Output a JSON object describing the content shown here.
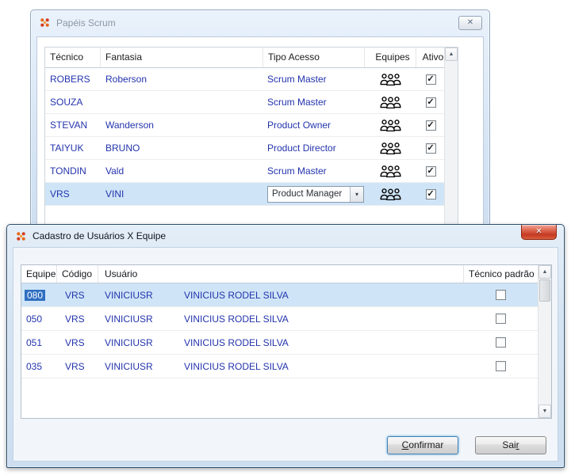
{
  "icons": {
    "close": "✕",
    "check": "✓",
    "dropdown": "▾",
    "scroll_up": "▲",
    "scroll_down": "▼"
  },
  "papeis": {
    "title": "Papéis Scrum",
    "headers": {
      "tecnico": "Técnico",
      "fantasia": "Fantasia",
      "tipo": "Tipo Acesso",
      "equipes": "Equipes",
      "ativo": "Ativo"
    },
    "rows": [
      {
        "tecnico": "ROBERS",
        "fantasia": "Roberson",
        "tipo": "Scrum Master",
        "ativo": true
      },
      {
        "tecnico": "SOUZA",
        "fantasia": "",
        "tipo": "Scrum Master",
        "ativo": true
      },
      {
        "tecnico": "STEVAN",
        "fantasia": "Wanderson",
        "tipo": "Product Owner",
        "ativo": true
      },
      {
        "tecnico": "TAIYUK",
        "fantasia": "BRUNO",
        "tipo": "Product Director",
        "ativo": true
      },
      {
        "tecnico": "TONDIN",
        "fantasia": "Vald",
        "tipo": "Scrum Master",
        "ativo": true
      },
      {
        "tecnico": "VRS",
        "fantasia": "VINI",
        "tipo": "Product Manager",
        "ativo": true
      }
    ]
  },
  "cadastro": {
    "title": "Cadastro de Usuários X  Equipe",
    "headers": {
      "equipe": "Equipe",
      "codigo": "Código",
      "usuario": "Usuário",
      "tecnico_padrao": "Técnico padrão"
    },
    "rows": [
      {
        "equipe": "080",
        "codigo": "VRS",
        "usuario": "VINICIUSR",
        "nome": "VINICIUS RODEL SILVA",
        "tecnico_padrao": false
      },
      {
        "equipe": "050",
        "codigo": "VRS",
        "usuario": "VINICIUSR",
        "nome": "VINICIUS RODEL SILVA",
        "tecnico_padrao": false
      },
      {
        "equipe": "051",
        "codigo": "VRS",
        "usuario": "VINICIUSR",
        "nome": "VINICIUS RODEL SILVA",
        "tecnico_padrao": false
      },
      {
        "equipe": "035",
        "codigo": "VRS",
        "usuario": "VINICIUSR",
        "nome": "VINICIUS RODEL SILVA",
        "tecnico_padrao": false
      }
    ],
    "buttons": {
      "confirmar_key": "C",
      "confirmar_rest": "onfirmar",
      "sair_pre": "Sai",
      "sair_key": "r"
    }
  },
  "colors": {
    "grid_text": "#2334ad",
    "row_selected": "#cfe5f7",
    "cell_selected": "#2f6fc1",
    "close_red": "#c43a23",
    "title_inactive": "#8a97a5"
  }
}
